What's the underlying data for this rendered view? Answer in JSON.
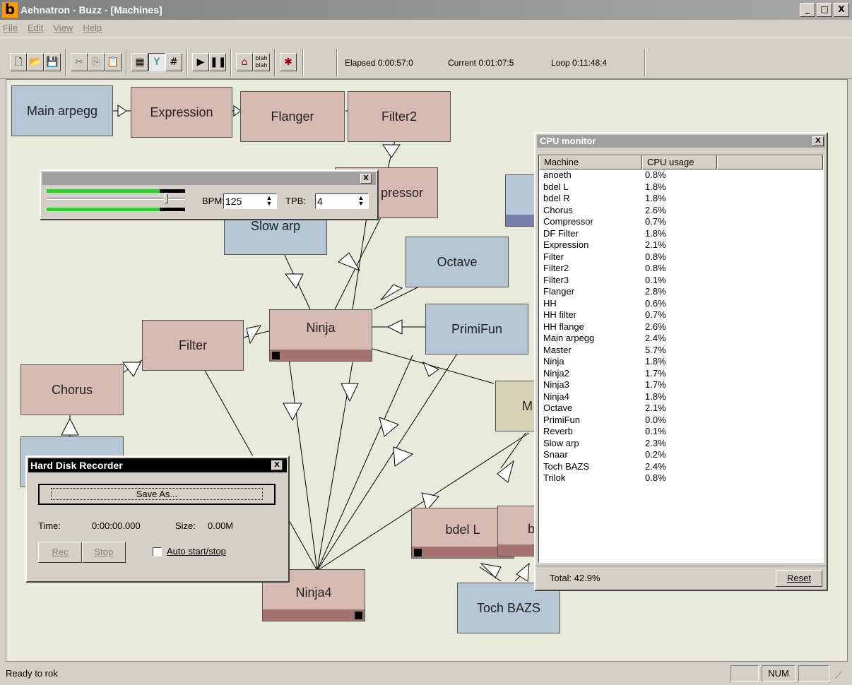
{
  "window": {
    "title": "Aehnatron - Buzz - [Machines]",
    "app_icon": "b",
    "minimize": "_",
    "maximize": "□",
    "close": "X"
  },
  "menu": [
    "File",
    "Edit",
    "View",
    "Help"
  ],
  "toolbar": {
    "elapsed": "Elapsed 0:00:57:0",
    "current": "Current 0:01:07:5",
    "loop": "Loop 0:11:48:4",
    "blah": "blah blah"
  },
  "machines": {
    "main_arpegg": "Main arpegg",
    "expression": "Expression",
    "flanger": "Flanger",
    "filter2": "Filter2",
    "compressor": "pressor",
    "slow_arp": "Slow arp",
    "octave": "Octave",
    "ninja": "Ninja",
    "primifun": "PrimiFun",
    "filter": "Filter",
    "chorus": "Chorus",
    "master": "M",
    "bdel_l": "bdel L",
    "bdel_r": "b",
    "ninja4": "Ninja4",
    "toch_bazs": "Toch BAZS"
  },
  "tempo": {
    "bpm_label": "BPM:",
    "bpm_value": "125",
    "tpb_label": "TPB:",
    "tpb_value": "4"
  },
  "recorder": {
    "title": "Hard Disk Recorder",
    "save_as": "Save As...",
    "time_label": "Time:",
    "time_value": "0:00:00.000",
    "size_label": "Size:",
    "size_value": "0.00M",
    "rec": "Rec",
    "stop": "Stop",
    "auto": "Auto start/stop"
  },
  "cpu": {
    "title": "CPU monitor",
    "col_machine": "Machine",
    "col_usage": "CPU usage",
    "rows": [
      {
        "m": "anoeth",
        "u": "0.8%"
      },
      {
        "m": "bdel L",
        "u": "1.8%"
      },
      {
        "m": "bdel R",
        "u": "1.8%"
      },
      {
        "m": "Chorus",
        "u": "2.6%"
      },
      {
        "m": "Compressor",
        "u": "0.7%"
      },
      {
        "m": "DF Filter",
        "u": "1.8%"
      },
      {
        "m": "Expression",
        "u": "2.1%"
      },
      {
        "m": "Filter",
        "u": "0.8%"
      },
      {
        "m": "Filter2",
        "u": "0.8%"
      },
      {
        "m": "Filter3",
        "u": "0.1%"
      },
      {
        "m": "Flanger",
        "u": "2.8%"
      },
      {
        "m": "HH",
        "u": "0.6%"
      },
      {
        "m": "HH filter",
        "u": "0.7%"
      },
      {
        "m": "HH flange",
        "u": "2.6%"
      },
      {
        "m": "Main arpegg",
        "u": "2.4%"
      },
      {
        "m": "Master",
        "u": "5.7%"
      },
      {
        "m": "Ninja",
        "u": "1.8%"
      },
      {
        "m": "Ninja2",
        "u": "1.7%"
      },
      {
        "m": "Ninja3",
        "u": "1.7%"
      },
      {
        "m": "Ninja4",
        "u": "1.8%"
      },
      {
        "m": "Octave",
        "u": "2.1%"
      },
      {
        "m": "PrimiFun",
        "u": "0.0%"
      },
      {
        "m": "Reverb",
        "u": "0.1%"
      },
      {
        "m": "Slow arp",
        "u": "2.3%"
      },
      {
        "m": "Snaar",
        "u": "0.2%"
      },
      {
        "m": "Toch BAZS",
        "u": "2.4%"
      },
      {
        "m": "Trilok",
        "u": "0.8%"
      }
    ],
    "total": "Total: 42.9%",
    "reset": "Reset"
  },
  "status": {
    "text": "Ready to rok",
    "num": "NUM"
  }
}
